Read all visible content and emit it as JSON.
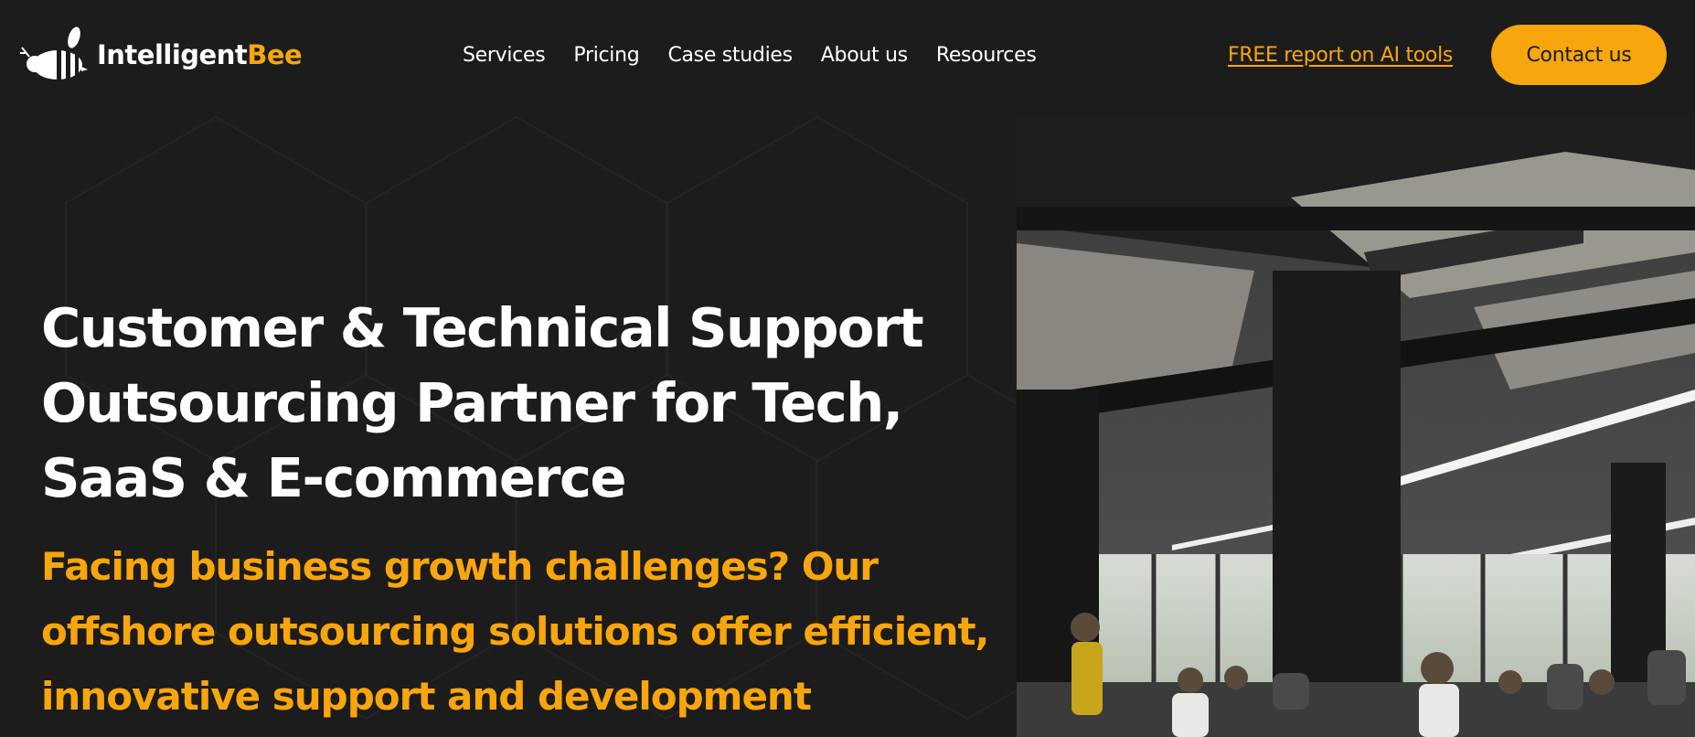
{
  "brand": {
    "name_part1": "Intelligent",
    "name_part2": "Bee",
    "icon": "bee-icon"
  },
  "nav": {
    "items": [
      {
        "label": "Services"
      },
      {
        "label": "Pricing"
      },
      {
        "label": "Case studies"
      },
      {
        "label": "About us"
      },
      {
        "label": "Resources"
      }
    ]
  },
  "header": {
    "report_link": "FREE report on AI tools",
    "contact_button": "Contact us"
  },
  "hero": {
    "title_lines": [
      "Customer & Technical Support",
      "Outsourcing Partner for Tech,",
      "SaaS & E-commerce"
    ],
    "subtitle_lines": [
      "Facing business growth challenges? Our",
      "offshore outsourcing solutions offer efficient,",
      "innovative support and development"
    ],
    "image": "office-photo"
  },
  "colors": {
    "background": "#1c1c1c",
    "accent": "#f7a60e",
    "text": "#ffffff"
  }
}
